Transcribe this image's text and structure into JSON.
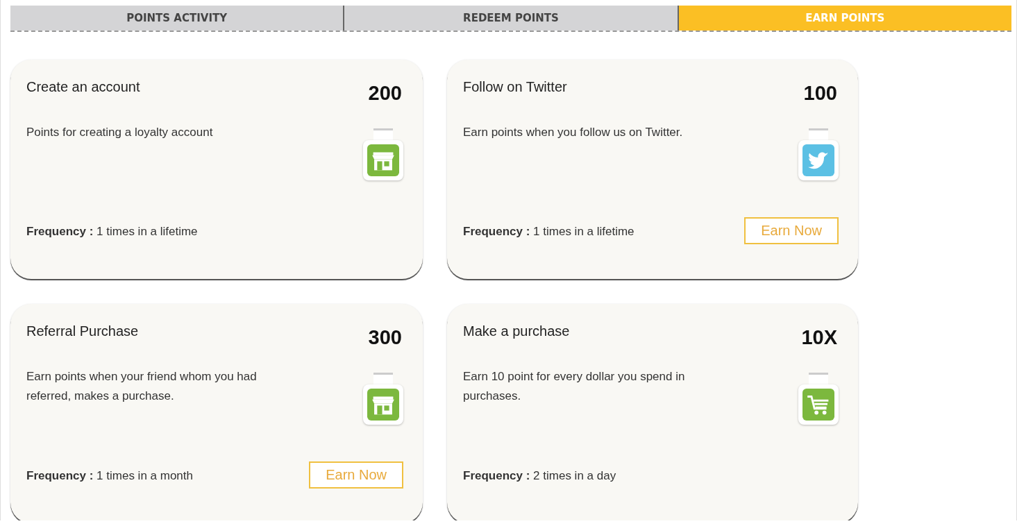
{
  "tabs": [
    {
      "label": "POINTS ACTIVITY",
      "selected": false
    },
    {
      "label": "REDEEM POINTS",
      "selected": false
    },
    {
      "label": "EARN POINTS",
      "selected": true
    }
  ],
  "cards": [
    {
      "title": "Create an account",
      "points": "200",
      "description": "Points for creating a loyalty account",
      "kind": "store",
      "frequency": "**Frequency :** 1 times in a lifetime"
    },
    {
      "title": "Follow on Twitter",
      "points": "100",
      "description": "Earn points when you follow us on Twitter.",
      "kind": "twitter",
      "frequency": "**Frequency :** 1 times in a lifetime",
      "button": "Earn Now"
    },
    {
      "title": "Referral Purchase",
      "points": "300",
      "description": "Earn points when your friend whom you had referred, makes a purchase.",
      "kind": "store",
      "frequency": "**Frequency :** 1 times in a month",
      "button": "Earn Now"
    },
    {
      "title": "Make a purchase",
      "points": "10X",
      "description": "Earn 10 point for every dollar you spend in purchases.",
      "kind": "cart",
      "frequency": "**Frequency :** 2 times in a day"
    }
  ]
}
